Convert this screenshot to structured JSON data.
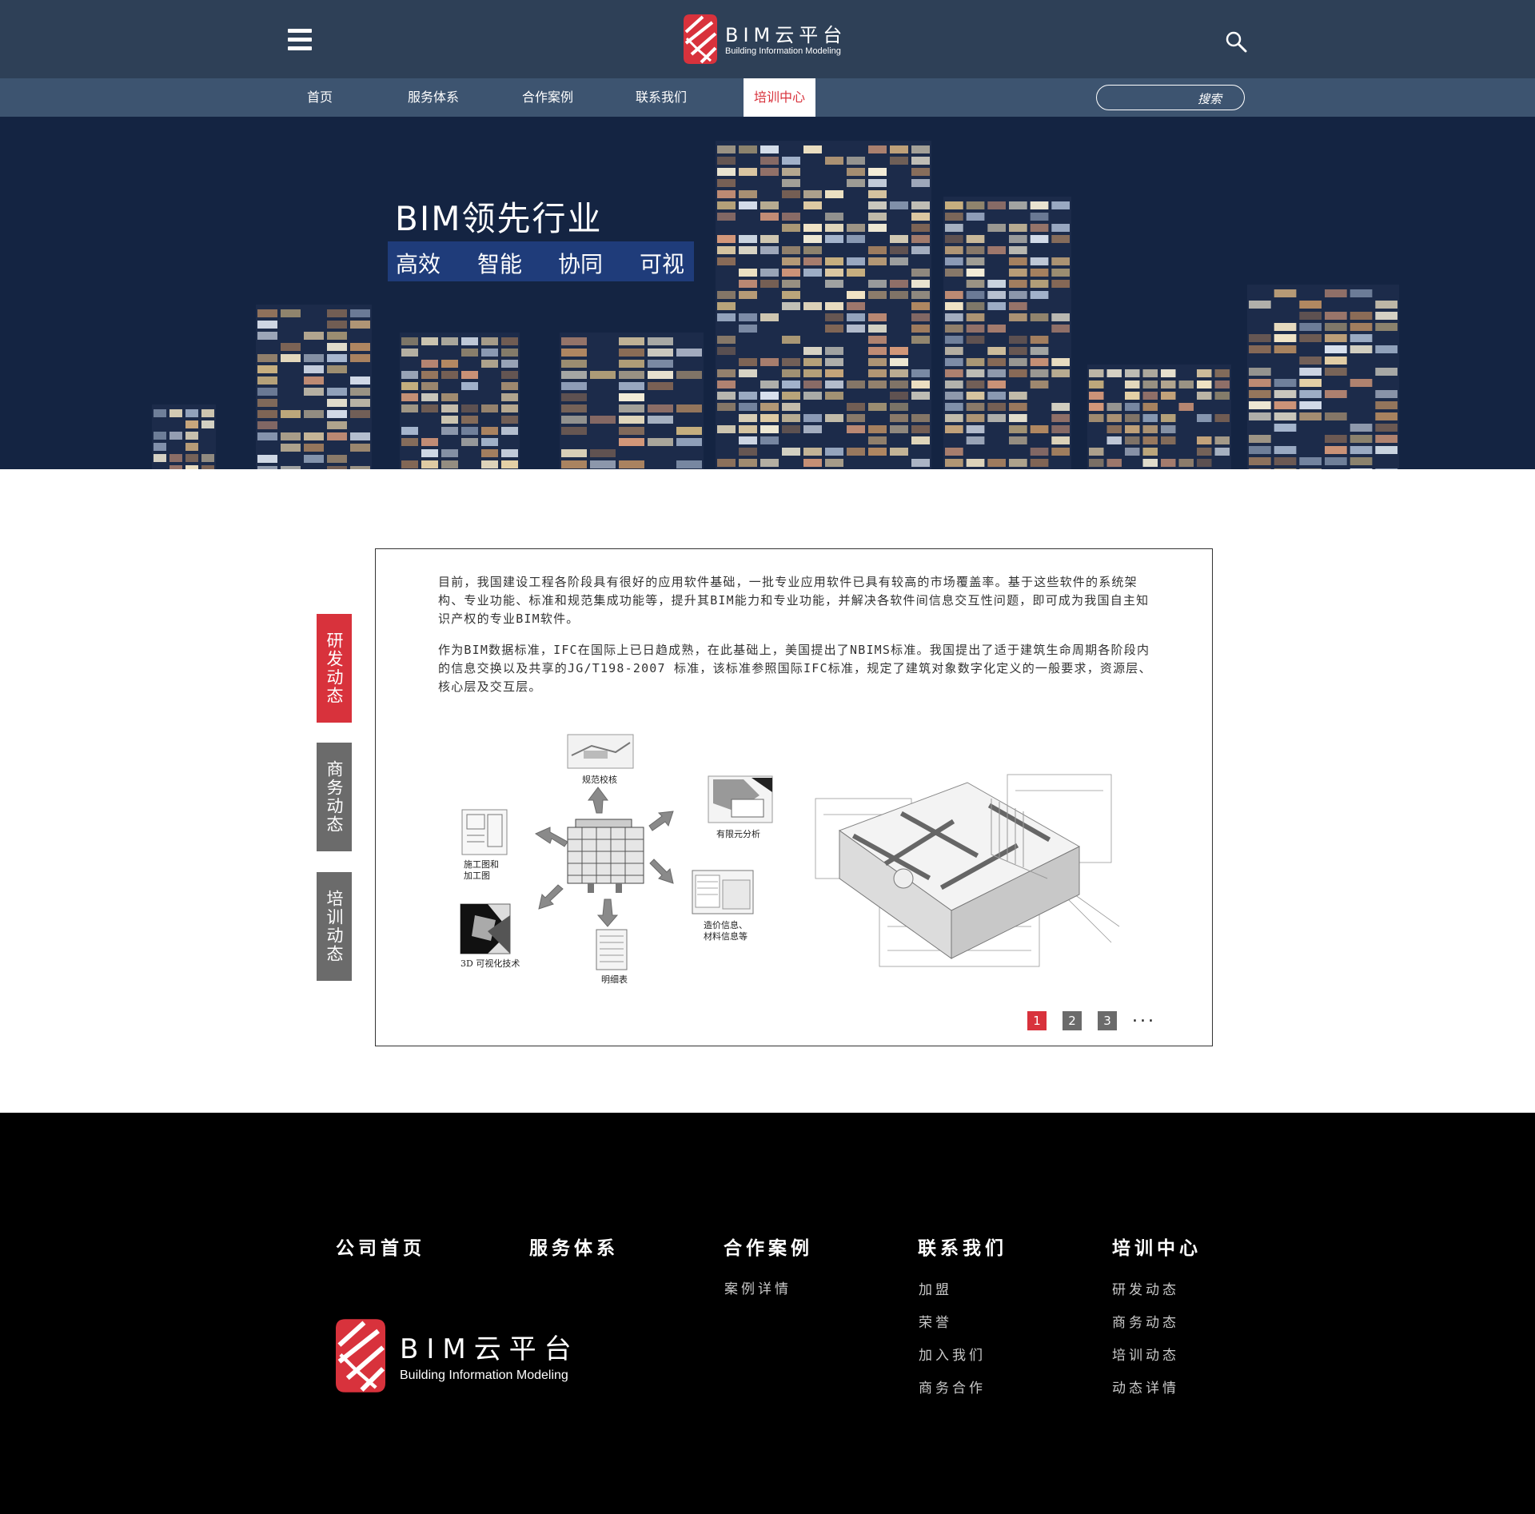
{
  "header": {
    "logo_title": "BIM云平台",
    "logo_subtitle": "Building Information Modeling",
    "menu_icon": "hamburger-menu-icon",
    "search_icon": "magnifier-icon"
  },
  "nav": {
    "items": [
      {
        "label": "首页",
        "active": false
      },
      {
        "label": "服务体系",
        "active": false
      },
      {
        "label": "合作案例",
        "active": false
      },
      {
        "label": "联系我们",
        "active": false
      },
      {
        "label": "培训中心",
        "active": true
      }
    ],
    "search_placeholder": "搜索"
  },
  "banner": {
    "title": "BIM领先行业",
    "tags": [
      "高效",
      "智能",
      "协同",
      "可视"
    ]
  },
  "side_tabs": [
    {
      "label": "研发动态",
      "active": true
    },
    {
      "label": "商务动态",
      "active": false
    },
    {
      "label": "培训动态",
      "active": false
    }
  ],
  "content": {
    "paragraph1": "目前，我国建设工程各阶段具有很好的应用软件基础，一批专业应用软件已具有较高的市场覆盖率。基于这些软件的系统架构、专业功能、标准和规范集成功能等，提升其BIM能力和专业功能，并解决各软件间信息交互性问题，即可成为我国自主知识产权的专业BIM软件。",
    "paragraph2": "作为BIM数据标准，IFC在国际上已日趋成熟，在此基础上，美国提出了NBIMS标准。我国提出了适于建筑生命周期各阶段内的信息交换以及共享的JG/T198-2007 标准，该标准参照国际IFC标准，规定了建筑对象数字化定义的一般要求，资源层、核心层及交互层。",
    "diagram_labels": {
      "top": "规范校核",
      "right_top": "有限元分析",
      "left_top_1": "施工图和",
      "left_top_2": "加工图",
      "left_bottom": "3D 可视化技术",
      "bottom": "明细表",
      "right_bottom_1": "造价信息、",
      "right_bottom_2": "材料信息等"
    },
    "pagination": {
      "pages": [
        "1",
        "2",
        "3"
      ],
      "current": "1",
      "more": "..."
    }
  },
  "footer": {
    "columns": [
      {
        "heading": "公司首页",
        "links": []
      },
      {
        "heading": "服务体系",
        "links": []
      },
      {
        "heading": "合作案例",
        "links": [
          "案例详情"
        ]
      },
      {
        "heading": "联系我们",
        "links": [
          "加盟",
          "荣誉",
          "加入我们",
          "商务合作"
        ]
      },
      {
        "heading": "培训中心",
        "links": [
          "研发动态",
          "商务动态",
          "培训动态",
          "动态详情"
        ]
      }
    ],
    "logo_title": "BIM云平台",
    "logo_subtitle": "Building Information Modeling"
  },
  "colors": {
    "header_bg": "#2e4057",
    "nav_bg": "#3d5470",
    "accent_red": "#d8323c",
    "banner_bg": "#142442",
    "footer_bg": "#000000",
    "tab_gray": "#6b6b6b"
  }
}
